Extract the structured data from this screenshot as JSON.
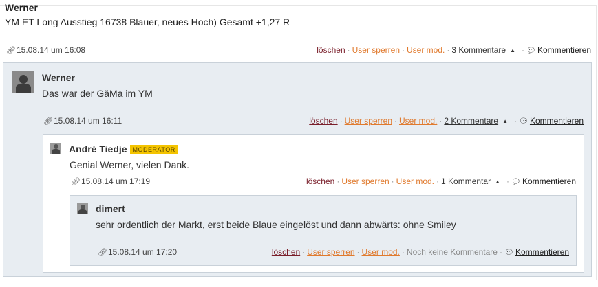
{
  "post": {
    "author": "Werner",
    "text": "YM ET Long Ausstieg 16738 Blauer, neues Hoch) Gesamt +1,27 R",
    "timestamp": "15.08.14 um 16:08",
    "actions": {
      "delete": "löschen",
      "block_user": "User sperren",
      "user_mod": "User mod.",
      "comments_count": "3 Kommentare",
      "comment": "Kommentieren"
    }
  },
  "comments": [
    {
      "author": "Werner",
      "text": "Das war der GäMa im YM",
      "timestamp": "15.08.14 um 16:11",
      "actions": {
        "delete": "löschen",
        "block_user": "User sperren",
        "user_mod": "User mod.",
        "comments_count": "2 Kommentare",
        "comment": "Kommentieren"
      }
    },
    {
      "author": "André Tiedje",
      "badge": "MODERATOR",
      "text": "Genial Werner, vielen Dank.",
      "timestamp": "15.08.14 um 17:19",
      "actions": {
        "delete": "löschen",
        "block_user": "User sperren",
        "user_mod": "User mod.",
        "comments_count": "1 Kommentar",
        "comment": "Kommentieren"
      }
    },
    {
      "author": "dimert",
      "text": "sehr ordentlich der Markt, erst beide Blaue eingelöst und dann abwärts: ohne Smiley",
      "timestamp": "15.08.14 um 17:20",
      "actions": {
        "delete": "löschen",
        "block_user": "User sperren",
        "user_mod": "User mod.",
        "no_comments": "Noch keine Kommentare",
        "comment": "Kommentieren"
      }
    }
  ],
  "icons": {
    "permalink": "link-icon",
    "collapse": "caret-up-icon",
    "comment": "speech-bubble-icon"
  },
  "colors": {
    "delete_link": "#7a1f2b",
    "mod_links": "#e07a2e",
    "moderator_badge": "#f4c400",
    "comment_box_bg": "#e8edf2"
  }
}
